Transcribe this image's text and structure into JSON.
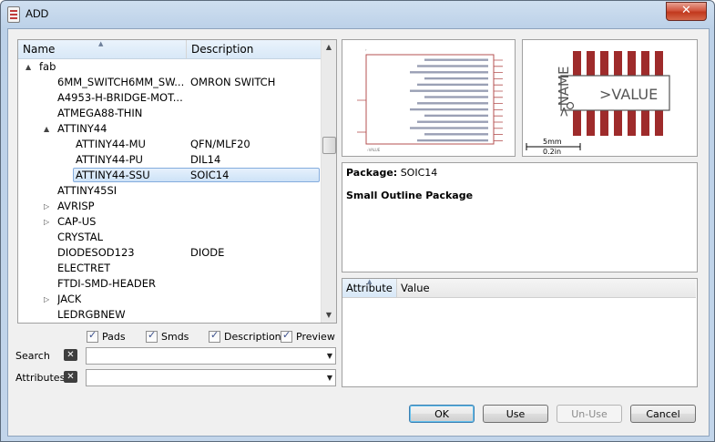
{
  "window": {
    "title": "ADD",
    "close_glyph": "✕"
  },
  "tree": {
    "columns": [
      "Name",
      "Description"
    ],
    "rows": [
      {
        "name": "fab",
        "desc": "",
        "level": 0,
        "expander": "▲",
        "selected": false
      },
      {
        "name": "6MM_SWITCH6MM_SW...",
        "desc": "OMRON SWITCH",
        "level": 1,
        "expander": "",
        "selected": false
      },
      {
        "name": "A4953-H-BRIDGE-MOT...",
        "desc": "",
        "level": 1,
        "expander": "",
        "selected": false
      },
      {
        "name": "ATMEGA88-THIN",
        "desc": "",
        "level": 1,
        "expander": "",
        "selected": false
      },
      {
        "name": "ATTINY44",
        "desc": "",
        "level": 1,
        "expander": "▲",
        "selected": false
      },
      {
        "name": "ATTINY44-MU",
        "desc": "QFN/MLF20",
        "level": 2,
        "expander": "",
        "selected": false
      },
      {
        "name": "ATTINY44-PU",
        "desc": "DIL14",
        "level": 2,
        "expander": "",
        "selected": false
      },
      {
        "name": "ATTINY44-SSU",
        "desc": "SOIC14",
        "level": 2,
        "expander": "",
        "selected": true
      },
      {
        "name": "ATTINY45SI",
        "desc": "",
        "level": 1,
        "expander": "",
        "selected": false
      },
      {
        "name": "AVRISP",
        "desc": "",
        "level": 1,
        "expander": "▷",
        "selected": false
      },
      {
        "name": "CAP-US",
        "desc": "",
        "level": 1,
        "expander": "▷",
        "selected": false
      },
      {
        "name": "CRYSTAL",
        "desc": "",
        "level": 1,
        "expander": "",
        "selected": false
      },
      {
        "name": "DIODESOD123",
        "desc": "DIODE",
        "level": 1,
        "expander": "",
        "selected": false
      },
      {
        "name": "ELECTRET",
        "desc": "",
        "level": 1,
        "expander": "",
        "selected": false
      },
      {
        "name": "FTDI-SMD-HEADER",
        "desc": "",
        "level": 1,
        "expander": "",
        "selected": false
      },
      {
        "name": "JACK",
        "desc": "",
        "level": 1,
        "expander": "▷",
        "selected": false
      },
      {
        "name": "LEDRGBNEW",
        "desc": "",
        "level": 1,
        "expander": "",
        "selected": false
      }
    ]
  },
  "filters": {
    "pads": "Pads",
    "smds": "Smds",
    "description": "Description",
    "preview": "Preview"
  },
  "search": {
    "label": "Search",
    "value": ""
  },
  "attributes_filter": {
    "label": "Attributes",
    "value": ""
  },
  "schematic_preview": {
    "pin_count_left": 2,
    "pin_count_right": 14
  },
  "package_preview": {
    "name_label": ">NAME",
    "value_label": ">VALUE",
    "scale_mm": "5mm",
    "scale_in": "0.2in",
    "pad_color": "#9e2b2b"
  },
  "package_info": {
    "label": "Package:",
    "value": "SOIC14",
    "description": "Small Outline Package"
  },
  "attribute_table": {
    "col_attribute": "Attribute",
    "col_value": "Value"
  },
  "buttons": {
    "ok": "OK",
    "use": "Use",
    "unuse": "Un-Use",
    "cancel": "Cancel"
  }
}
